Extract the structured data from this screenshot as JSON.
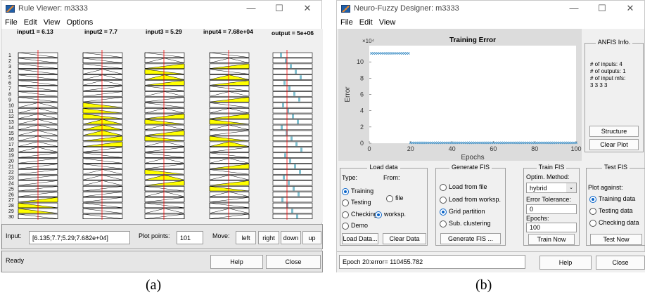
{
  "captions": {
    "a": "(a)",
    "b": "(b)"
  },
  "rule_viewer": {
    "title": "Rule Viewer: m3333",
    "menu": [
      "File",
      "Edit",
      "View",
      "Options"
    ],
    "columns": [
      "input1 = 6.13",
      "input2 = 7.7",
      "input3 = 5.29",
      "input4 = 7.68e+04",
      "output = 5e+06"
    ],
    "rule_numbers": [
      "1",
      "2",
      "3",
      "4",
      "5",
      "6",
      "7",
      "8",
      "9",
      "10",
      "11",
      "12",
      "13",
      "14",
      "15",
      "16",
      "17",
      "18",
      "19",
      "20",
      "21",
      "22",
      "23",
      "24",
      "25",
      "26",
      "27",
      "28",
      "29",
      "30"
    ],
    "fill_color": "#ffff00",
    "line_color": "#ff0000",
    "output_color": "#80c0d0",
    "input_label": "Input:",
    "input_value": "[6.135;7.7;5.29;7.682e+04]",
    "plot_points_label": "Plot points:",
    "plot_points_value": "101",
    "move_label": "Move:",
    "move_buttons": [
      "left",
      "right",
      "down",
      "up"
    ],
    "status": "Ready",
    "help": "Help",
    "close": "Close"
  },
  "nf_designer": {
    "title": "Neuro-Fuzzy Designer: m3333",
    "menu": [
      "File",
      "Edit",
      "View"
    ],
    "chart_data": {
      "type": "scatter",
      "title": "Training Error",
      "xlabel": "Epochs",
      "ylabel": "Error",
      "exponent_label": "×10⁴",
      "xlim": [
        0,
        100
      ],
      "ylim": [
        0,
        12
      ],
      "x_ticks": [
        "0",
        "20",
        "40",
        "60",
        "80",
        "100"
      ],
      "y_ticks": [
        "0",
        "2",
        "4",
        "6",
        "8",
        "10"
      ],
      "series": [
        {
          "x_range": [
            1,
            19
          ],
          "y": 11.05
        },
        {
          "x_range": [
            20,
            100
          ],
          "y": 0.05
        }
      ],
      "marker_color": "#2e86c1"
    },
    "anfis_info": {
      "title": "ANFIS Info.",
      "lines": [
        "# of inputs: 4",
        "# of outputs: 1",
        "# of input mfs:",
        "3 3 3 3"
      ],
      "structure": "Structure",
      "clear_plot": "Clear Plot"
    },
    "load_data": {
      "title": "Load data",
      "type_label": "Type:",
      "from_label": "From:",
      "types": [
        "Training",
        "Testing",
        "Checking",
        "Demo"
      ],
      "from": [
        "file",
        "worksp."
      ],
      "button_load": "Load Data...",
      "button_clear": "Clear Data"
    },
    "generate_fis": {
      "title": "Generate FIS",
      "options": [
        "Load from file",
        "Load from worksp.",
        "Grid partition",
        "Sub. clustering"
      ],
      "button": "Generate FIS ..."
    },
    "train_fis": {
      "title": "Train FIS",
      "optim_label": "Optim. Method:",
      "optim_value": "hybrid",
      "tol_label": "Error Tolerance:",
      "tol_value": "0",
      "epochs_label": "Epochs:",
      "epochs_value": "100",
      "button": "Train Now"
    },
    "test_fis": {
      "title": "Test FIS",
      "plot_against": "Plot against:",
      "options": [
        "Training data",
        "Testing data",
        "Checking data"
      ],
      "button": "Test Now"
    },
    "status": "Epoch 20:error= 110455.782",
    "help": "Help",
    "close": "Close"
  }
}
